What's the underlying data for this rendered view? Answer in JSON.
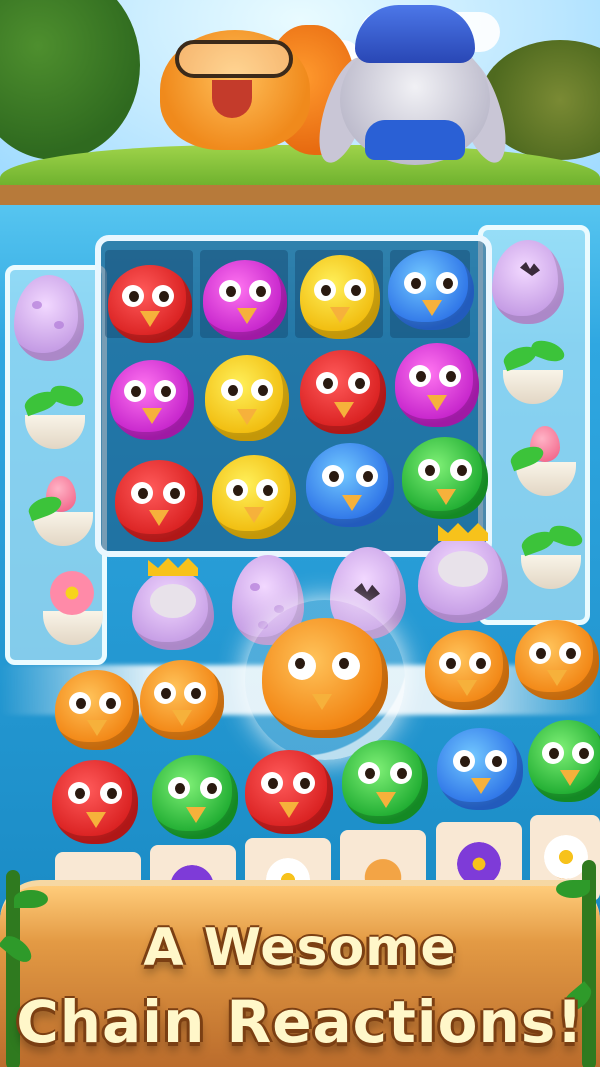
{
  "headline": {
    "line1": "A Wesome",
    "line2": "Chain Reactions!"
  },
  "characters": {
    "left": "squirrel-with-glasses",
    "right": "bunny-in-police-hat"
  },
  "board": {
    "grid_rows": [
      [
        "red-bird",
        "pink-bird",
        "yellow-bird",
        "blue-bird"
      ],
      [
        "pink-bird",
        "yellow-bird",
        "red-bird",
        "pink-bird"
      ],
      [
        "red-bird",
        "yellow-bird",
        "blue-bird",
        "green-bird"
      ]
    ],
    "left_column": [
      "egg",
      "sprout-pot",
      "tulip-pot",
      "flower-pot"
    ],
    "right_column": [
      "cracked-egg",
      "sprout-pot",
      "tulip-pot",
      "sprout-pot"
    ],
    "special_row": [
      "crowned-egg",
      "egg",
      "cracked-egg",
      "crowned-egg"
    ],
    "chain_row": [
      "orange-bird",
      "orange-bird",
      "orange-bird-in-bubble",
      "orange-bird",
      "orange-bird"
    ],
    "bottom_row": [
      "red-bird",
      "green-bird",
      "red-bird",
      "green-bird",
      "blue-bird",
      "green-bird"
    ],
    "blocker_row": [
      "swirl-tile",
      "purple-flower-tile",
      "white-flower-tile",
      "swirl-tile",
      "purple-flower-tile",
      "white-flower-tile"
    ]
  },
  "colors": {
    "banner_text": "#fff7c9",
    "banner_outline": "#7b3f13",
    "water": "#2fa7e1"
  }
}
